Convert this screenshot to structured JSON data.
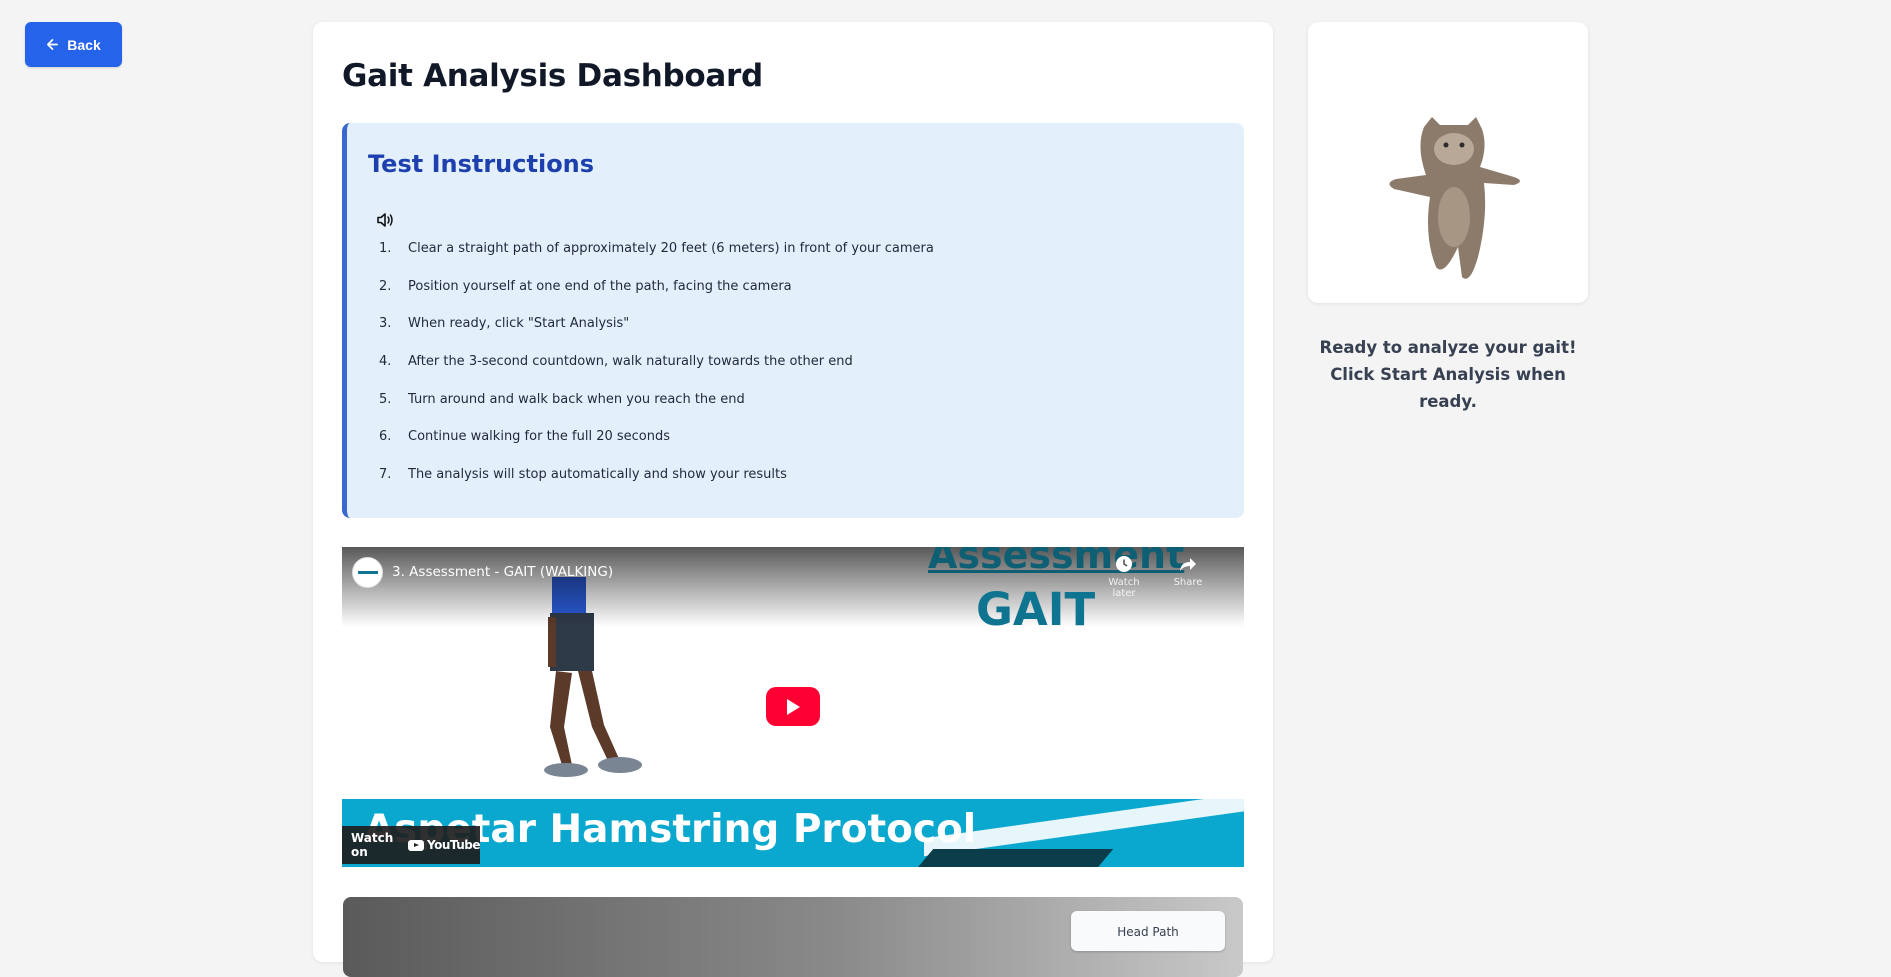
{
  "nav": {
    "back_label": "Back"
  },
  "page": {
    "title": "Gait Analysis Dashboard"
  },
  "instructions": {
    "title": "Test Instructions",
    "steps": [
      {
        "num": "1.",
        "text": "Clear a straight path of approximately 20 feet (6 meters) in front of your camera"
      },
      {
        "num": "2.",
        "text": "Position yourself at one end of the path, facing the camera"
      },
      {
        "num": "3.",
        "text": "When ready, click \"Start Analysis\""
      },
      {
        "num": "4.",
        "text": "After the 3-second countdown, walk naturally towards the other end"
      },
      {
        "num": "5.",
        "text": "Turn around and walk back when you reach the end"
      },
      {
        "num": "6.",
        "text": "Continue walking for the full 20 seconds"
      },
      {
        "num": "7.",
        "text": "The analysis will stop automatically and show your results"
      }
    ]
  },
  "video": {
    "title": "3. Assessment - GAIT (WALKING)",
    "heading_top": "Assessment",
    "heading_main": "GAIT",
    "watch_later": "Watch later",
    "share": "Share",
    "banner": "Aspetar Hamstring Protocol",
    "watch_on": "Watch on",
    "youtube": "YouTube"
  },
  "camera": {
    "head_path_label": "Head Path"
  },
  "status": {
    "message": "Ready to analyze your gait! Click Start Analysis when ready."
  },
  "colors": {
    "accent": "#2563eb",
    "instructions_bg": "#e3f0fc",
    "instructions_border": "#3b67d1",
    "youtube_red": "#ff0033",
    "banner": "#0aa7cf"
  }
}
